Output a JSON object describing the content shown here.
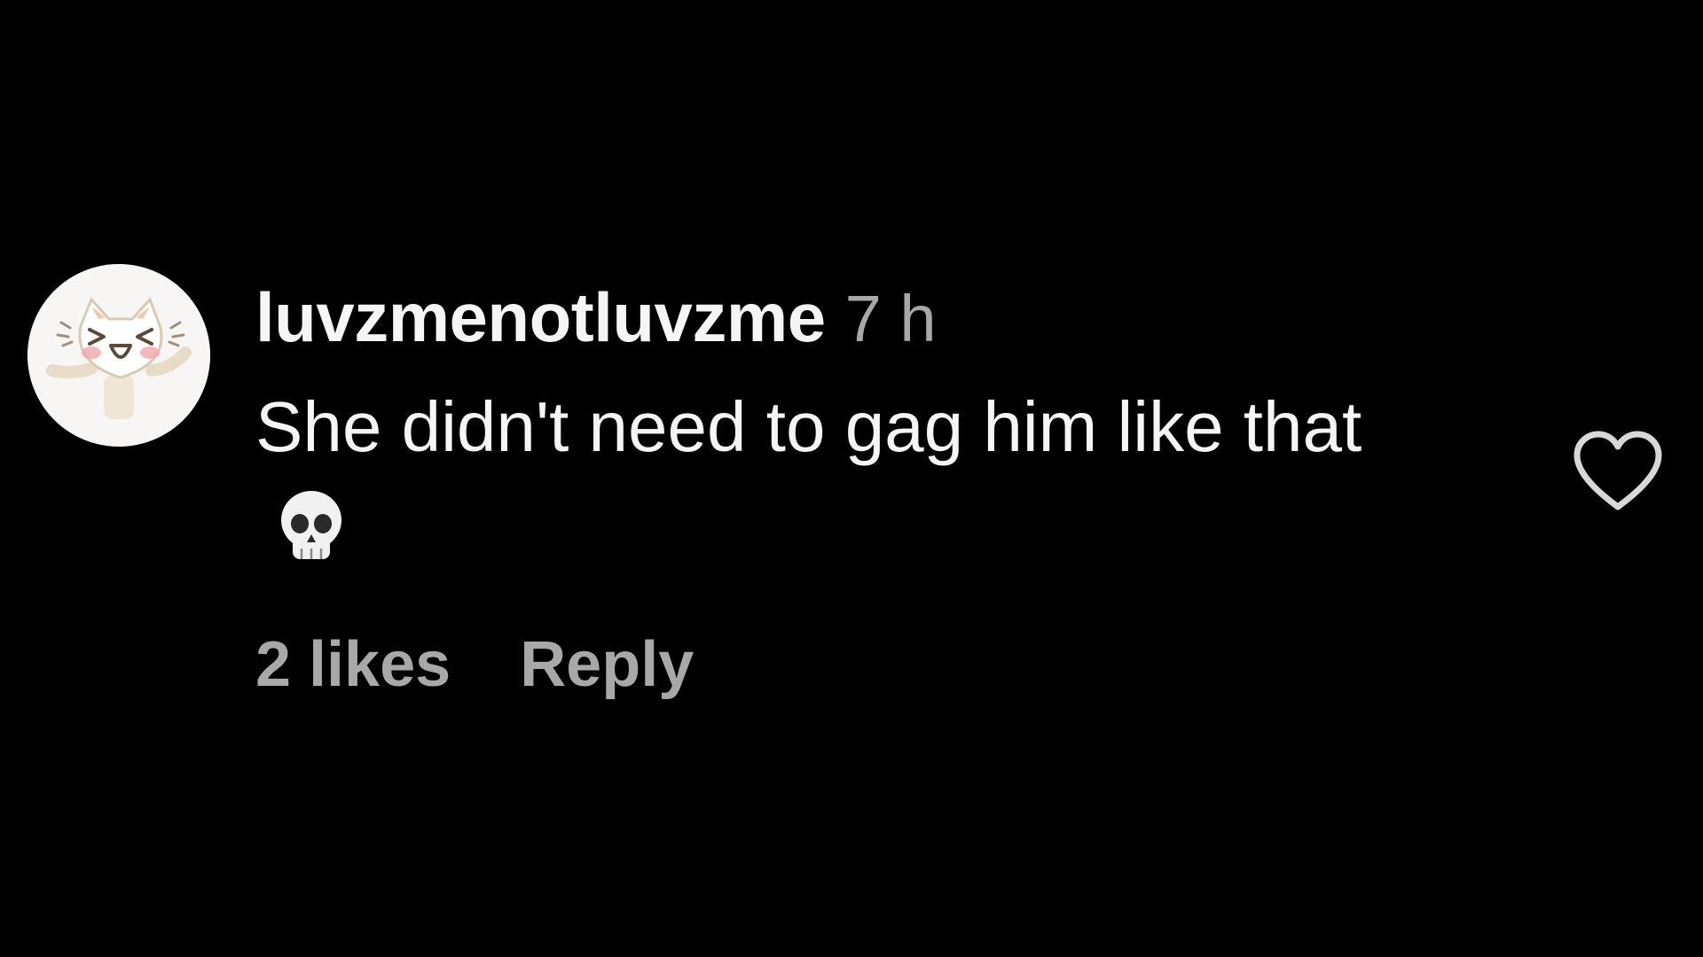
{
  "comment": {
    "avatar_icon": "cat-avatar-icon",
    "username": "luvzmenotluvzme",
    "timestamp": "7 h",
    "text": "She didn't need to gag him like that",
    "emoji_icon": "skull-emoji-icon",
    "likes_label": "2 likes",
    "reply_label": "Reply",
    "like_icon": "heart-outline-icon"
  },
  "colors": {
    "background": "#000000",
    "primary_text": "#f5f5f5",
    "secondary_text": "#a8a8a8",
    "avatar_bg": "#f7f6f4"
  }
}
